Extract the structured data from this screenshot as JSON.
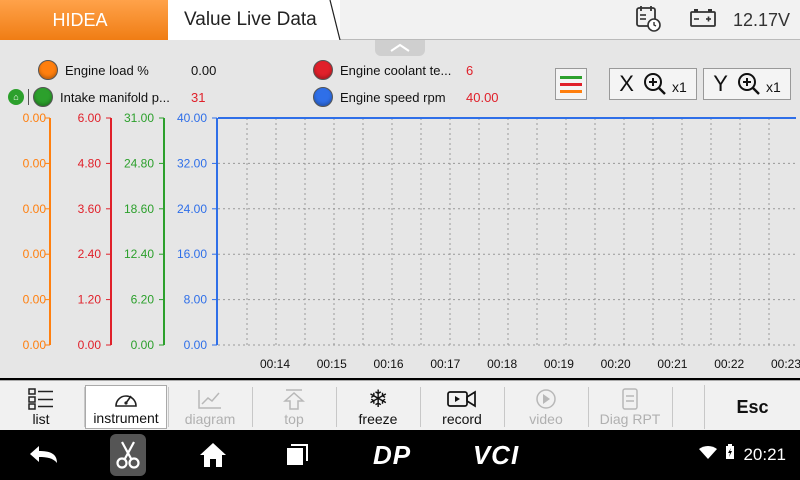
{
  "header": {
    "brand": "HIDEA",
    "title": "Value Live Data",
    "voltage": "12.17V"
  },
  "legend": [
    {
      "name": "Engine load",
      "unit": "%",
      "value": "0.00",
      "color": "#ff7f0e",
      "value_color": "#111111"
    },
    {
      "name": "Engine coolant te...",
      "unit": "",
      "value": "6",
      "color": "#e0202a",
      "value_color": "#e0202a"
    },
    {
      "name": "Intake manifold p...",
      "unit": "",
      "value": "31",
      "color": "#2ca02c",
      "value_color": "#e0202a"
    },
    {
      "name": "Engine speed",
      "unit": "rpm",
      "value": "40.00",
      "color": "#2f6fe8",
      "value_color": "#e0202a"
    }
  ],
  "zoom": {
    "x_label": "X",
    "x_factor": "x1",
    "y_label": "Y",
    "y_factor": "x1"
  },
  "chart_data": {
    "type": "line",
    "x": [
      "00:14",
      "00:15",
      "00:16",
      "00:17",
      "00:18",
      "00:19",
      "00:20",
      "00:21",
      "00:22",
      "00:23"
    ],
    "axes": [
      {
        "ticks": [
          "0.00",
          "0.00",
          "0.00",
          "0.00",
          "0.00",
          "0.00"
        ],
        "color": "#ff7f0e"
      },
      {
        "ticks": [
          "6.00",
          "4.80",
          "3.60",
          "2.40",
          "1.20",
          "0.00"
        ],
        "color": "#e0202a"
      },
      {
        "ticks": [
          "31.00",
          "24.80",
          "18.60",
          "12.40",
          "6.20",
          "0.00"
        ],
        "color": "#2ca02c"
      },
      {
        "ticks": [
          "40.00",
          "32.00",
          "24.00",
          "16.00",
          "8.00",
          "0.00"
        ],
        "color": "#2f6fe8"
      }
    ],
    "series": [
      {
        "name": "Engine speed",
        "color": "#2f6fe8",
        "values": [
          40,
          40,
          40,
          40,
          40,
          40,
          40,
          40,
          40,
          40
        ],
        "ylim": [
          0,
          40
        ]
      }
    ],
    "grid": true
  },
  "toolbar": [
    {
      "key": "list",
      "label": "list",
      "state": "normal"
    },
    {
      "key": "instrument",
      "label": "instrument",
      "state": "normal"
    },
    {
      "key": "diagram",
      "label": "diagram",
      "state": "disabled"
    },
    {
      "key": "top",
      "label": "top",
      "state": "disabled"
    },
    {
      "key": "freeze",
      "label": "freeze",
      "state": "normal"
    },
    {
      "key": "record",
      "label": "record",
      "state": "normal"
    },
    {
      "key": "video",
      "label": "video",
      "state": "disabled"
    },
    {
      "key": "diag-rpt",
      "label": "Diag RPT",
      "state": "disabled"
    }
  ],
  "esc_label": "Esc",
  "navbar": {
    "brand_dp": "DP",
    "brand_vci": "VCI",
    "time": "20:21"
  }
}
